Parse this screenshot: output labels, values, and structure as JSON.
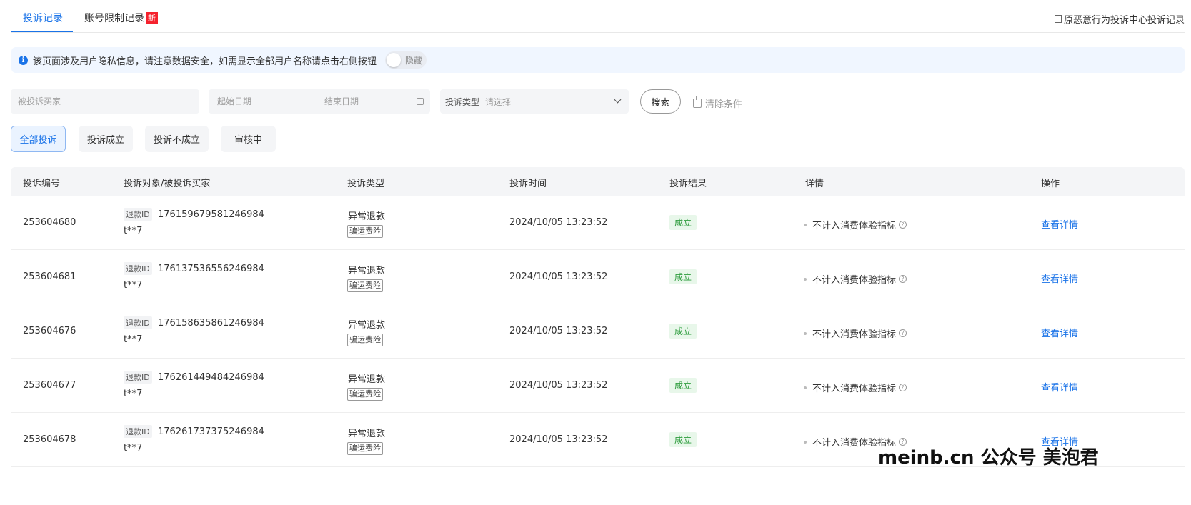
{
  "tabs": [
    {
      "label": "投诉记录",
      "active": true
    },
    {
      "label": "账号限制记录",
      "badge": "新"
    }
  ],
  "top_link": "原恶意行为投诉中心投诉记录",
  "notice": {
    "text": "该页面涉及用户隐私信息，请注意数据安全，如需显示全部用户名称请点击右侧按钮",
    "toggle_label": "隐藏"
  },
  "filters": {
    "buyer_placeholder": "被投诉买家",
    "start_date_placeholder": "起始日期",
    "end_date_placeholder": "结束日期",
    "type_label": "投诉类型",
    "type_placeholder": "请选择",
    "search_label": "搜索",
    "clear_label": "清除条件"
  },
  "status_chips": [
    "全部投诉",
    "投诉成立",
    "投诉不成立",
    "审核中"
  ],
  "columns": [
    "投诉编号",
    "投诉对象/被投诉买家",
    "投诉类型",
    "投诉时间",
    "投诉结果",
    "详情",
    "操作"
  ],
  "rows": [
    {
      "id": "253604680",
      "refund_tag": "退款ID",
      "refund_id": "176159679581246984",
      "buyer": "t**7",
      "type": "异常退款",
      "type_tag": "骗运费险",
      "time": "2024/10/05 13:23:52",
      "result": "成立",
      "detail": "不计入消费体验指标",
      "action": "查看详情"
    },
    {
      "id": "253604681",
      "refund_tag": "退款ID",
      "refund_id": "176137536556246984",
      "buyer": "t**7",
      "type": "异常退款",
      "type_tag": "骗运费险",
      "time": "2024/10/05 13:23:52",
      "result": "成立",
      "detail": "不计入消费体验指标",
      "action": "查看详情"
    },
    {
      "id": "253604676",
      "refund_tag": "退款ID",
      "refund_id": "176158635861246984",
      "buyer": "t**7",
      "type": "异常退款",
      "type_tag": "骗运费险",
      "time": "2024/10/05 13:23:52",
      "result": "成立",
      "detail": "不计入消费体验指标",
      "action": "查看详情"
    },
    {
      "id": "253604677",
      "refund_tag": "退款ID",
      "refund_id": "176261449484246984",
      "buyer": "t**7",
      "type": "异常退款",
      "type_tag": "骗运费险",
      "time": "2024/10/05 13:23:52",
      "result": "成立",
      "detail": "不计入消费体验指标",
      "action": "查看详情"
    },
    {
      "id": "253604678",
      "refund_tag": "退款ID",
      "refund_id": "176261737375246984",
      "buyer": "t**7",
      "type": "异常退款",
      "type_tag": "骗运费险",
      "time": "2024/10/05 13:23:52",
      "result": "成立",
      "detail": "不计入消费体验指标",
      "action": "查看详情"
    }
  ],
  "watermark": "meinb.cn 公众号 美泡君",
  "colors": {
    "accent": "#1a73e8",
    "success": "#2e9d3e",
    "success_bg": "#e8f7ea",
    "badge": "#f5222d"
  }
}
